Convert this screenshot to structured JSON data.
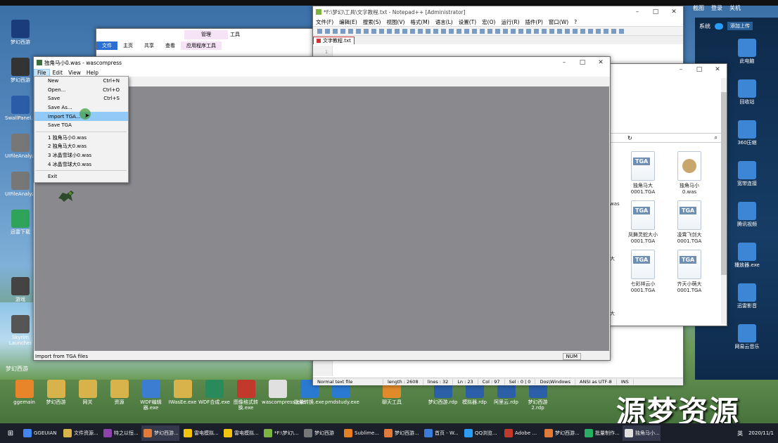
{
  "desktop_icons_left": [
    {
      "label": "梦幻西游",
      "color": "#1a3c7a"
    },
    {
      "label": "梦幻西游",
      "color": "#333"
    },
    {
      "label": "SwallPanel.exe",
      "color": "#2a5ca8"
    },
    {
      "label": "UIFileAnalyzer",
      "color": "#777"
    },
    {
      "label": "UIFileAnalyzer",
      "color": "#777"
    },
    {
      "label": "迅雷下载",
      "color": "#2fa35a"
    },
    {
      "label": "游戏",
      "color": "#444"
    },
    {
      "label": "Skyrim Launcher",
      "color": "#555"
    }
  ],
  "desktop_icons_right": [
    {
      "label": "此电脑"
    },
    {
      "label": "回收站"
    },
    {
      "label": "360压缩"
    },
    {
      "label": "宽带连接"
    },
    {
      "label": "腾讯视频"
    },
    {
      "label": "播放器.exe"
    },
    {
      "label": "迅雷影音"
    },
    {
      "label": "网易云音乐"
    }
  ],
  "right_panel": {
    "tab1": "系统",
    "tab2": "添加上传"
  },
  "bottom_desktop_icons": [
    {
      "label": "ggemain",
      "color": "#e8842a"
    },
    {
      "label": "梦幻西游",
      "color": "#d8b24a"
    },
    {
      "label": "网关",
      "color": "#d8b24a"
    },
    {
      "label": "资源",
      "color": "#d8b24a"
    },
    {
      "label": "WDF编辑器.exe",
      "color": "#3c7dd2"
    },
    {
      "label": "IWasEe.exe",
      "color": "#d8b24a"
    },
    {
      "label": "WDF合成.exe",
      "color": "#2a8a5a"
    },
    {
      "label": "图像格式转换.exe",
      "color": "#c0392b"
    },
    {
      "label": "wascompress.exe",
      "color": "#e0e0e0"
    },
    {
      "label": "批量转换.exe",
      "color": "#2a7ad2"
    },
    {
      "label": "pmdstudy.exe",
      "color": "#2a7ad2"
    },
    {
      "label": "聊天工具",
      "color": "#e08a2a"
    },
    {
      "label": "梦幻西游.rdp",
      "color": "#2b5fa8"
    },
    {
      "label": "模拟器.rdp",
      "color": "#2b5fa8"
    },
    {
      "label": "阿里云.rdp",
      "color": "#2b5fa8"
    },
    {
      "label": "梦幻西游2.rdp",
      "color": "#2b5fa8"
    }
  ],
  "bottom_desktop_label": "梦幻西游",
  "explorer_bg": {
    "ribbon_manage": "管理",
    "ribbon_tools": "工具",
    "tabs": [
      "文件",
      "主页",
      "共享",
      "查看",
      "应用程序工具"
    ]
  },
  "notepad": {
    "title": "*F:\\梦幻\\工具\\文字教程.txt - Notepad++ [Administrator]",
    "menus": [
      "文件(F)",
      "编辑(E)",
      "搜索(S)",
      "视图(V)",
      "格式(M)",
      "语言(L)",
      "设置(T)",
      "宏(O)",
      "运行(R)",
      "插件(P)",
      "窗口(W)",
      "?"
    ],
    "tab": "文字教程.txt",
    "status": [
      "Normal text file",
      "length : 2608",
      "lines : 32",
      "Ln : 23",
      "Col : 97",
      "Sel : 0 | 0",
      "Dos\\Windows",
      "ANSI as UTF-8",
      "INS"
    ],
    "ln": "1"
  },
  "explorer_files": [
    {
      "name": "TGA",
      "caption": "独角马大0001.TGA"
    },
    {
      "name": "",
      "caption": "独角马小0.was"
    },
    {
      "name": "TGA",
      "caption": "凤舞灵蛇大小0001.TGA"
    },
    {
      "name": "TGA",
      "caption": "凌霄飞剑大0001.TGA"
    },
    {
      "name": "TGA",
      "caption": "七彩祥云小0001.TGA"
    },
    {
      "name": "TGA",
      "caption": "齐天小萌大0001.TGA"
    }
  ],
  "explorer_partial_labels": [
    "was",
    "大",
    "大",
    "小"
  ],
  "wascompress": {
    "title": "独角马小0.was - wascompress",
    "menus": [
      "File",
      "Edit",
      "View",
      "Help"
    ],
    "status": "Import from TGA files",
    "num": "NUM",
    "file_menu": [
      {
        "label": "New",
        "shortcut": "Ctrl+N"
      },
      {
        "label": "Open...",
        "shortcut": "Ctrl+O"
      },
      {
        "label": "Save",
        "shortcut": "Ctrl+S"
      },
      {
        "label": "Save As...",
        "shortcut": ""
      },
      {
        "label": "Import TGA...",
        "shortcut": ""
      },
      {
        "label": "Save TGA",
        "shortcut": ""
      }
    ],
    "recent": [
      "1 独角马小0.was",
      "2 独角马大0.was",
      "3 冰晶雪球小0.was",
      "4 冰晶雪球大0.was"
    ],
    "exit": "Exit"
  },
  "top_right": {
    "items": [
      "截图",
      "登录",
      "关机"
    ]
  },
  "watermark": "源梦资源",
  "taskbar": {
    "items": [
      {
        "label": "GGEUIAN",
        "color": "#4285f4"
      },
      {
        "label": "文件资源...",
        "color": "#d8b24a"
      },
      {
        "label": "特之以恒...",
        "color": "#8e44ad"
      },
      {
        "label": "梦幻西游...",
        "color": "#e07b39"
      },
      {
        "label": "雷电模拟...",
        "color": "#f1c40f"
      },
      {
        "label": "雷电模拟...",
        "color": "#f1c40f"
      },
      {
        "label": "*F:\\梦幻\\...",
        "color": "#7cb342"
      },
      {
        "label": "梦幻西游",
        "color": "#777"
      },
      {
        "label": "Sublime...",
        "color": "#e67e22"
      },
      {
        "label": "梦幻西游...",
        "color": "#e07b39"
      },
      {
        "label": "首页 - W...",
        "color": "#3b7dd8"
      },
      {
        "label": "QQ浏览...",
        "color": "#2a9df4"
      },
      {
        "label": "Adobe ...",
        "color": "#c0392b"
      },
      {
        "label": "梦幻西游...",
        "color": "#e07b39"
      },
      {
        "label": "批量制作...",
        "color": "#27ae60"
      },
      {
        "label": "独角马小...",
        "color": "#e0e0e0"
      }
    ],
    "tray": "英",
    "date": "2020/11/1"
  }
}
